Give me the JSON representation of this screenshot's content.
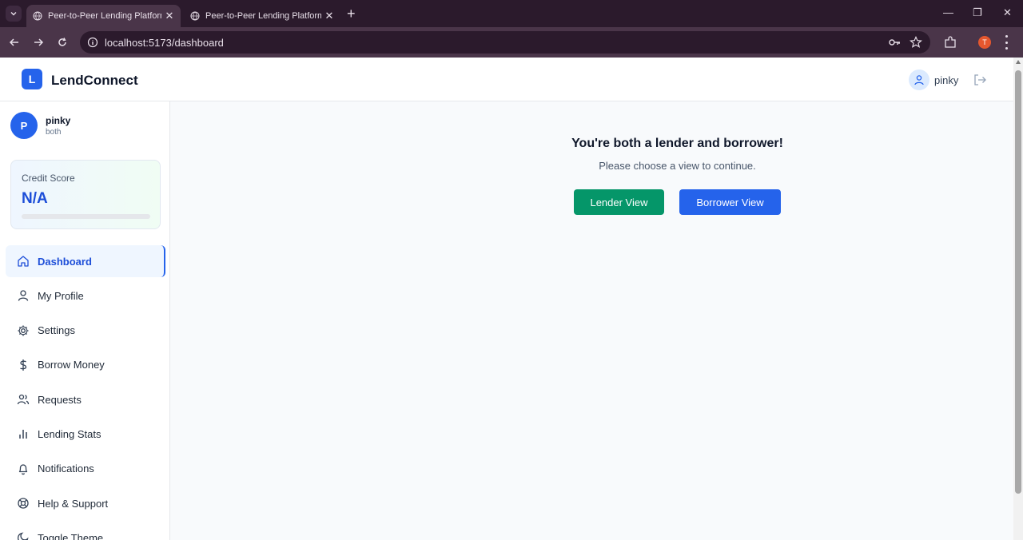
{
  "browser": {
    "tabs": [
      {
        "title": "Peer-to-Peer Lending Platform",
        "active": true
      },
      {
        "title": "Peer-to-Peer Lending Platform",
        "active": false
      }
    ],
    "url": "localhost:5173/dashboard",
    "profile_initial": "T"
  },
  "header": {
    "logo_letter": "L",
    "brand": "LendConnect",
    "username": "pinky"
  },
  "sidebar": {
    "avatar_initial": "P",
    "name": "pinky",
    "role": "both",
    "credit": {
      "label": "Credit Score",
      "value": "N/A",
      "progress": 0
    },
    "items": [
      {
        "label": "Dashboard",
        "icon": "home-icon",
        "active": true
      },
      {
        "label": "My Profile",
        "icon": "user-icon"
      },
      {
        "label": "Settings",
        "icon": "gear-icon"
      },
      {
        "label": "Borrow Money",
        "icon": "dollar-icon"
      },
      {
        "label": "Requests",
        "icon": "users-icon"
      },
      {
        "label": "Lending Stats",
        "icon": "bar-chart-icon"
      },
      {
        "label": "Notifications",
        "icon": "bell-icon"
      },
      {
        "label": "Help & Support",
        "icon": "lifebuoy-icon"
      },
      {
        "label": "Toggle Theme",
        "icon": "moon-icon"
      }
    ]
  },
  "main": {
    "title": "You're both a lender and borrower!",
    "subtitle": "Please choose a view to continue.",
    "lender_button": "Lender View",
    "borrower_button": "Borrower View"
  },
  "colors": {
    "primary": "#2563eb",
    "lender": "#059669",
    "chrome": "#4a3549"
  }
}
